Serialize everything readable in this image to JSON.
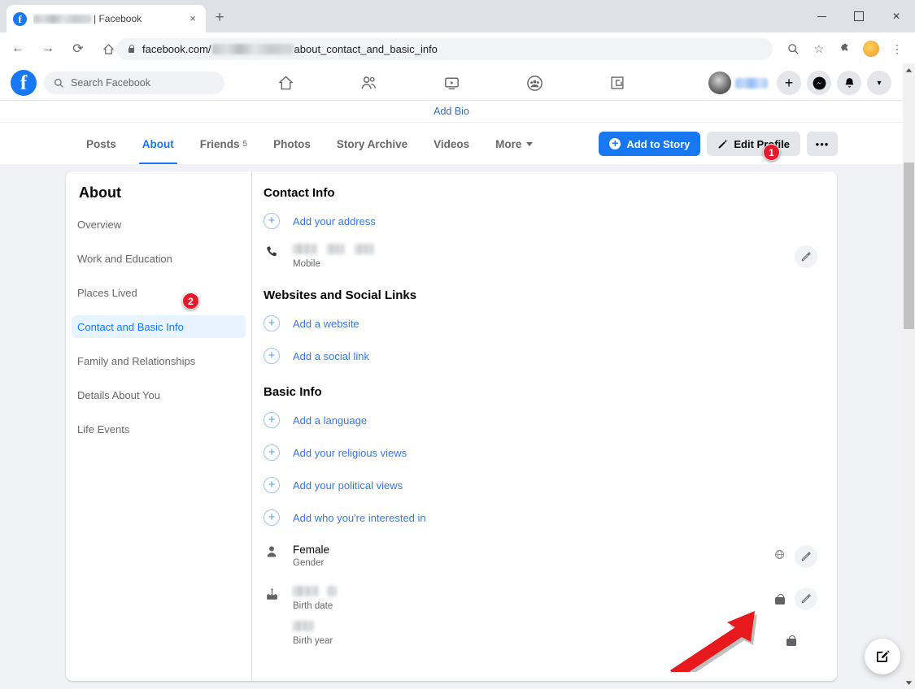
{
  "browser": {
    "tab": {
      "title_suffix": "| Facebook",
      "favicon": "facebook-favicon",
      "close": "×",
      "newtab": "+"
    },
    "nav": {
      "back": "←",
      "forward": "→",
      "reload": "⟳",
      "home": "⌂"
    },
    "url": {
      "domain": "facebook.com/",
      "path": "about_contact_and_basic_info",
      "lock": "lock-icon"
    },
    "toolbar": {
      "zoom": "search-icon",
      "bookmark": "☆",
      "extensions": "puzzle-icon",
      "profile": "browser-profile-avatar",
      "menu": "⋮"
    },
    "window": {
      "minimize": "minimize",
      "maximize": "maximize",
      "close": "✕"
    }
  },
  "fb_header": {
    "logo": "facebook-logo",
    "search_placeholder": "Search Facebook",
    "nav_icons": [
      "home-icon",
      "friends-icon",
      "watch-icon",
      "groups-icon",
      "gaming-icon"
    ],
    "profile_chip": "profile-name-blurred",
    "create_label": "+",
    "messenger": "messenger-icon",
    "notifications": "bell-icon",
    "account_caret": "▾"
  },
  "profile": {
    "bio_link": "Add Bio",
    "tabs": [
      {
        "label": "Posts",
        "active": false,
        "count": ""
      },
      {
        "label": "About",
        "active": true,
        "count": ""
      },
      {
        "label": "Friends",
        "active": false,
        "count": "5"
      },
      {
        "label": "Photos",
        "active": false,
        "count": ""
      },
      {
        "label": "Story Archive",
        "active": false,
        "count": ""
      },
      {
        "label": "Videos",
        "active": false,
        "count": ""
      },
      {
        "label": "More",
        "active": false,
        "count": ""
      }
    ],
    "actions": {
      "add_to_story": "Add to Story",
      "edit_profile": "Edit Profile",
      "more_dots": "•••"
    }
  },
  "sidebar": {
    "title": "About",
    "items": [
      {
        "label": "Overview",
        "active": false
      },
      {
        "label": "Work and Education",
        "active": false
      },
      {
        "label": "Places Lived",
        "active": false
      },
      {
        "label": "Contact and Basic Info",
        "active": true
      },
      {
        "label": "Family and Relationships",
        "active": false
      },
      {
        "label": "Details About You",
        "active": false
      },
      {
        "label": "Life Events",
        "active": false
      }
    ]
  },
  "content": {
    "contact_info": {
      "title": "Contact Info",
      "add_address": "Add your address",
      "phone": {
        "value_blurred": true,
        "sublabel": "Mobile",
        "icon": "phone-icon",
        "edit": "pencil-icon"
      }
    },
    "websites": {
      "title": "Websites and Social Links",
      "add_website": "Add a website",
      "add_social": "Add a social link"
    },
    "basic_info": {
      "title": "Basic Info",
      "add_language": "Add a language",
      "add_religious": "Add your religious views",
      "add_political": "Add your political views",
      "add_interested": "Add who you're interested in",
      "gender": {
        "value": "Female",
        "sublabel": "Gender",
        "icon": "person-icon",
        "privacy": "globe-icon",
        "edit": "pencil-icon"
      },
      "birth_date": {
        "value_blurred": true,
        "sublabel": "Birth date",
        "icon": "cake-icon",
        "privacy": "lock-icon",
        "edit": "pencil-icon"
      },
      "birth_year": {
        "value_blurred": true,
        "sublabel": "Birth year",
        "privacy": "lock-icon"
      }
    }
  },
  "annotations": {
    "badge_1": "1",
    "badge_2": "2",
    "arrow": "red-arrow-pointing-to-birth-date-lock"
  },
  "fab": {
    "icon": "compose-icon"
  },
  "colors": {
    "fb_blue": "#1877f2",
    "link_blue": "#3578e5",
    "badge_red": "#e8192c",
    "page_bg": "#f0f2f5",
    "arrow_red": "#e8191d"
  }
}
